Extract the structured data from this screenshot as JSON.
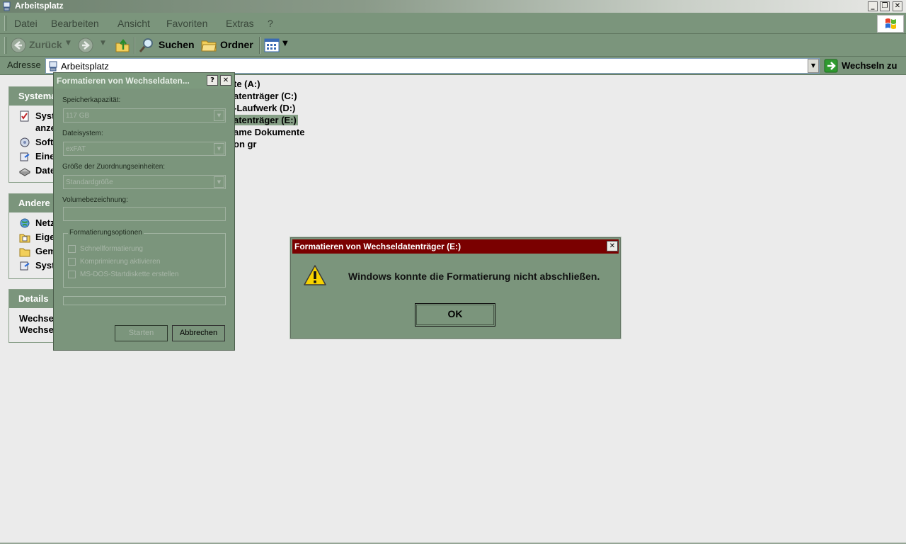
{
  "window": {
    "title": "Arbeitsplatz"
  },
  "menu": [
    "Datei",
    "Bearbeiten",
    "Ansicht",
    "Favoriten",
    "Extras",
    "?"
  ],
  "toolbar": {
    "back": "Zurück",
    "search": "Suchen",
    "folders": "Ordner"
  },
  "address": {
    "label": "Adresse",
    "value": "Arbeitsplatz",
    "go": "Wechseln zu"
  },
  "panels": {
    "system": {
      "header": "Systema",
      "items": [
        "Syst",
        "anze",
        "Soft",
        "Eine",
        "Date"
      ]
    },
    "other": {
      "header": "Andere",
      "items": [
        "Netz",
        "Eige",
        "Gem",
        "Syst"
      ]
    },
    "details": {
      "header": "Details",
      "lines": [
        "Wechse",
        "Wechse"
      ]
    }
  },
  "drives": [
    "te (A:)",
    "atenträger (C:)",
    "-Laufwerk (D:)",
    "atenträger (E:)",
    "ame Dokumente",
    "on gr"
  ],
  "format_dialog": {
    "title": "Formatieren von Wechseldaten...",
    "capacity_label": "Speicherkapazität:",
    "capacity_value": "117 GB",
    "fs_label": "Dateisystem:",
    "fs_value": "exFAT",
    "alloc_label": "Größe der Zuordnungseinheiten:",
    "alloc_value": "Standardgröße",
    "volume_label": "Volumebezeichnung:",
    "volume_value": "",
    "options_label": "Formatierungsoptionen",
    "options": [
      "Schnellformatierung",
      "Komprimierung aktivieren",
      "MS-DOS-Startdiskette erstellen"
    ],
    "start": "Starten",
    "cancel": "Abbrechen"
  },
  "error_dialog": {
    "title": "Formatieren von Wechseldatenträger (E:)",
    "message": "Windows konnte die Formatierung nicht abschließen.",
    "ok": "OK",
    "icon": "warning-icon"
  },
  "colors": {
    "chrome": "#7b957c",
    "error_title": "#7a0000",
    "desktop": "#ebebeb"
  }
}
